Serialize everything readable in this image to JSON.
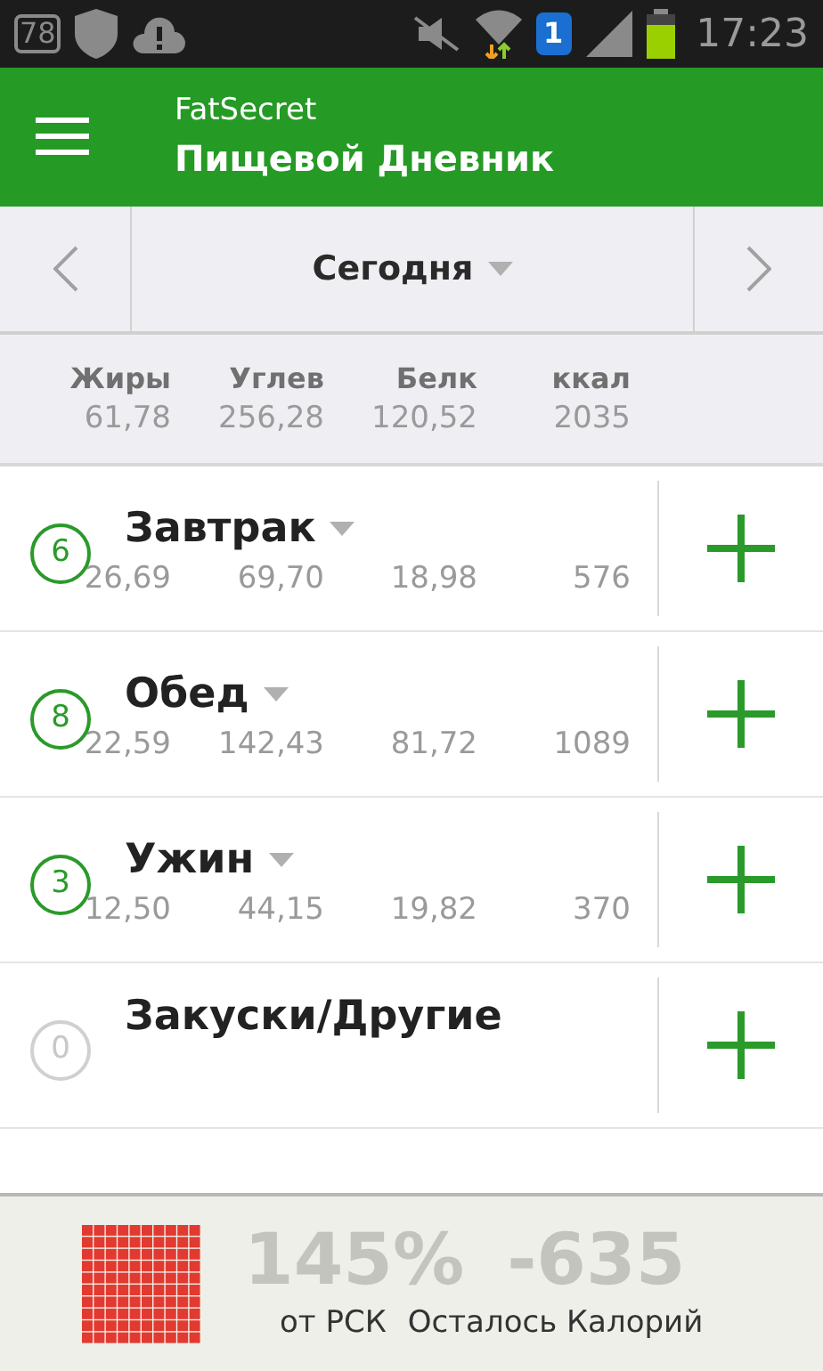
{
  "status_bar": {
    "notification_count": "78",
    "time": "17:23",
    "sim": "1"
  },
  "app_bar": {
    "app_name": "FatSecret",
    "title": "Пищевой Дневник"
  },
  "date_nav": {
    "label": "Сегодня"
  },
  "totals": {
    "columns": [
      {
        "label": "Жиры",
        "value": "61,78"
      },
      {
        "label": "Углев",
        "value": "256,28"
      },
      {
        "label": "Белк",
        "value": "120,52"
      },
      {
        "label": "ккал",
        "value": "2035"
      }
    ]
  },
  "meals": [
    {
      "count": "6",
      "name": "Завтрак",
      "active": true,
      "values": [
        "26,69",
        "69,70",
        "18,98",
        "576"
      ]
    },
    {
      "count": "8",
      "name": "Обед",
      "active": true,
      "values": [
        "22,59",
        "142,43",
        "81,72",
        "1089"
      ]
    },
    {
      "count": "3",
      "name": "Ужин",
      "active": true,
      "values": [
        "12,50",
        "44,15",
        "19,82",
        "370"
      ]
    },
    {
      "count": "0",
      "name": "Закуски/Другие",
      "active": false
    }
  ],
  "summary": {
    "percent": "145%",
    "percent_label": "от РСК",
    "remaining": "-635",
    "remaining_label": "Осталось Калорий"
  }
}
